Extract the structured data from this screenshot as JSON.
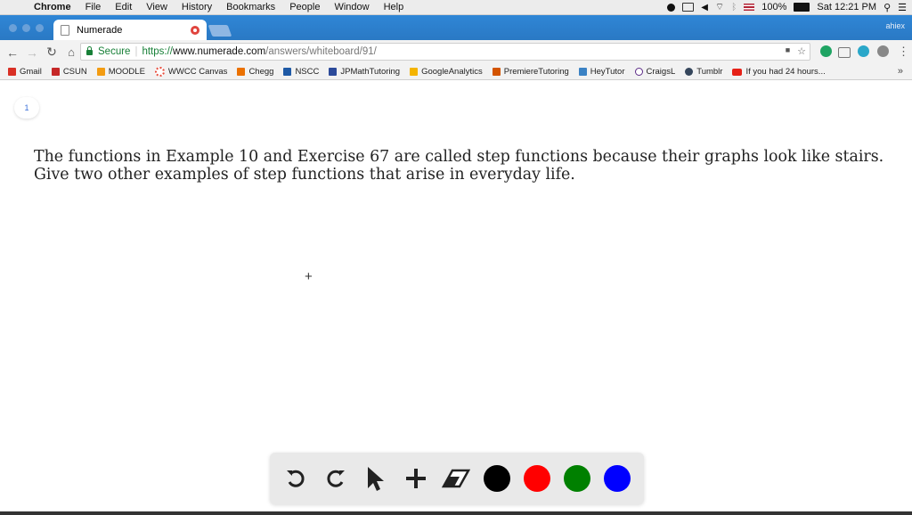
{
  "menubar": {
    "app": "Chrome",
    "items": [
      "File",
      "Edit",
      "View",
      "History",
      "Bookmarks",
      "People",
      "Window",
      "Help"
    ],
    "battery": "100%",
    "clock": "Sat 12:21 PM"
  },
  "tab": {
    "title": "Numerade"
  },
  "profile": {
    "label": "ahiex"
  },
  "address": {
    "secure_label": "Secure",
    "scheme": "https://",
    "host": "www.numerade.com",
    "path": "/answers/whiteboard/91/"
  },
  "bookmarks": [
    {
      "label": "Gmail",
      "color": "#d93025"
    },
    {
      "label": "CSUN",
      "color": "#c62828"
    },
    {
      "label": "MOODLE",
      "color": "#f39c12"
    },
    {
      "label": "WWCC Canvas",
      "color": "#e74c3c"
    },
    {
      "label": "Chegg",
      "color": "#eb7100"
    },
    {
      "label": "NSCC",
      "color": "#1f5aa6"
    },
    {
      "label": "JPMathTutoring",
      "color": "#2c4a9a"
    },
    {
      "label": "GoogleAnalytics",
      "color": "#f4b400"
    },
    {
      "label": "PremiereTutoring",
      "color": "#d35400"
    },
    {
      "label": "HeyTutor",
      "color": "#3b82c4"
    },
    {
      "label": "CraigsL",
      "color": "#5b2a86"
    },
    {
      "label": "Tumblr",
      "color": "#35465c"
    },
    {
      "label": "If you had 24 hours...",
      "color": "#e62117"
    }
  ],
  "page": {
    "page_number": "1",
    "question": "The functions in Example 10 and Exercise 67 are called step functions because their graphs look like stairs. Give two other examples of step functions that arise in everyday life."
  },
  "drawbar": {
    "colors": [
      "#000000",
      "#ff0000",
      "#008000",
      "#0000ff"
    ]
  }
}
